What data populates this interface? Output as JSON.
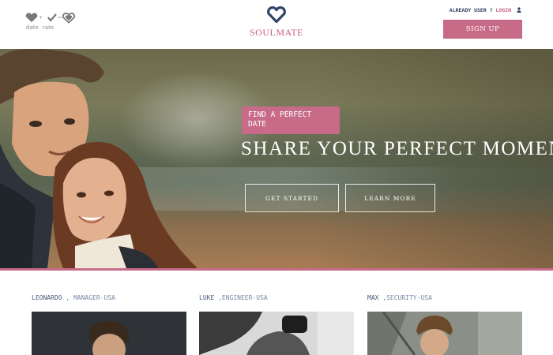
{
  "header": {
    "mini_logo": {
      "left_label": "date",
      "right_label": "rate",
      "icons": [
        "heart-icon",
        "check-heart-icon",
        "heart-outline-icon"
      ]
    },
    "brand": {
      "name": "SOULMATE",
      "icon": "heart-outline-icon"
    },
    "account": {
      "prefix": "ALREADY USER ?",
      "login_label": "LOGIN",
      "icon": "user-icon"
    },
    "signup_label": "SIGN UP"
  },
  "hero": {
    "tagline": "FIND A PERFECT DATE",
    "headline": "SHARE YOUR PERFECT MOMENTS",
    "buttons": {
      "get_started": "GET STARTED",
      "learn_more": "LEARN MORE"
    }
  },
  "profiles": [
    {
      "name": "LEONARDO",
      "separator": " , ",
      "role": "MANAGER-USA"
    },
    {
      "name": "LUKE",
      "separator": " ,",
      "role": "ENGINEER-USA"
    },
    {
      "name": "MAX",
      "separator": " ,",
      "role": "SECURITY-USA"
    }
  ],
  "colors": {
    "accent": "#c86b88",
    "brand_text": "#c9617d",
    "navy": "#2f3f60",
    "muted_caption": "#7a8aa6"
  }
}
